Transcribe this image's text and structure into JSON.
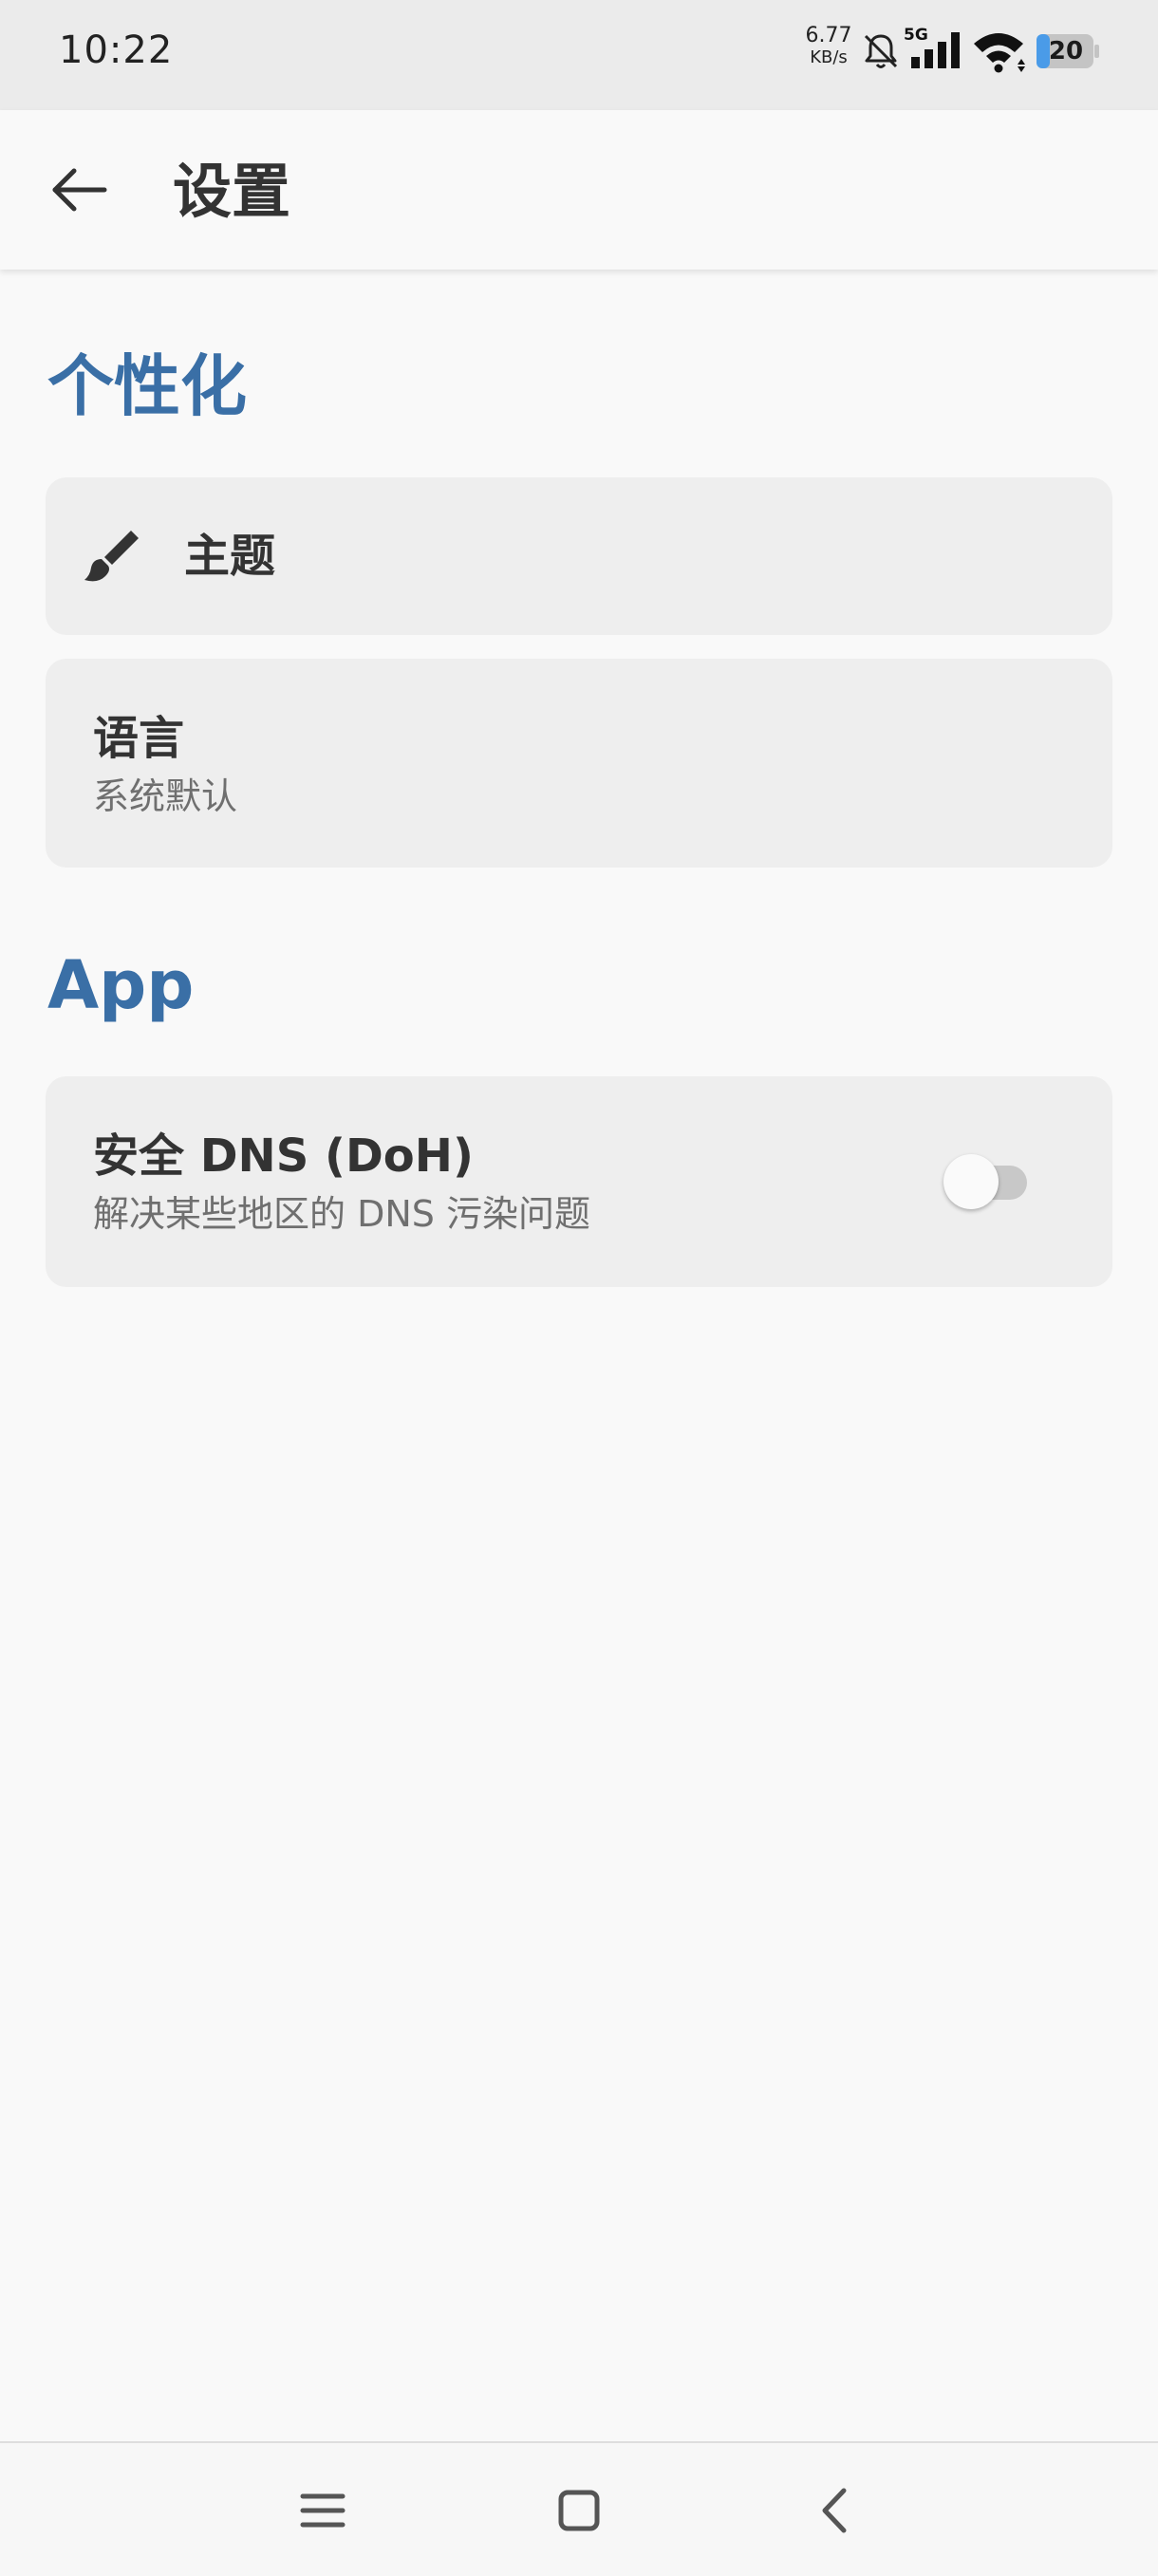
{
  "status_bar": {
    "time": "10:22",
    "net_speed_value": "6.77",
    "net_speed_unit": "KB/s",
    "network_type": "5G",
    "battery_level": "20"
  },
  "app_bar": {
    "back_icon": "arrow-left-icon",
    "title": "设置"
  },
  "sections": [
    {
      "header": "个性化",
      "items": [
        {
          "icon": "brush-icon",
          "title": "主题"
        },
        {
          "title": "语言",
          "subtitle": "系统默认"
        }
      ]
    },
    {
      "header": "App",
      "items": [
        {
          "title": "安全 DNS (DoH)",
          "subtitle": "解决某些地区的 DNS 污染问题",
          "toggle_on": false
        }
      ]
    }
  ],
  "nav_bar": {
    "icons": [
      "menu-icon",
      "home-square-icon",
      "back-chevron-icon"
    ]
  },
  "colors": {
    "accent": "#3a6fa6",
    "card": "#eeeeee",
    "background": "#f9f9f9"
  }
}
